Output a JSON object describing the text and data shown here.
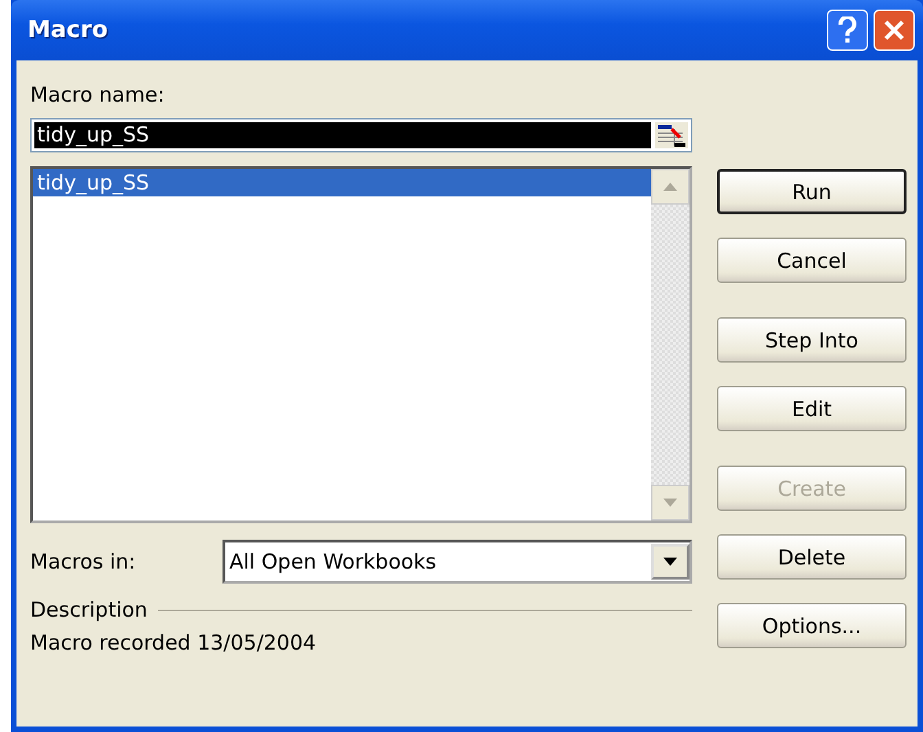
{
  "window": {
    "title": "Macro"
  },
  "macro_name": {
    "label": "Macro name:",
    "value": "tidy_up_SS"
  },
  "macro_list": [
    {
      "name": "tidy_up_SS",
      "selected": true
    }
  ],
  "macros_in": {
    "label": "Macros in:",
    "value": "All Open Workbooks"
  },
  "description": {
    "label": "Description",
    "text": "Macro recorded 13/05/2004"
  },
  "buttons": [
    {
      "label": "Run",
      "disabled": false,
      "default": true
    },
    {
      "label": "Cancel",
      "disabled": false,
      "default": false
    },
    {
      "label": "Step Into",
      "disabled": false,
      "default": false
    },
    {
      "label": "Edit",
      "disabled": false,
      "default": false
    },
    {
      "label": "Create",
      "disabled": true,
      "default": false
    },
    {
      "label": "Delete",
      "disabled": false,
      "default": false
    },
    {
      "label": "Options...",
      "disabled": false,
      "default": false
    }
  ]
}
